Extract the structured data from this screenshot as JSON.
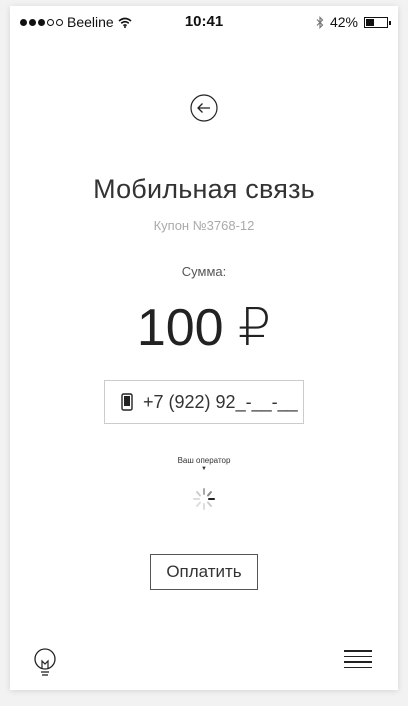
{
  "status_bar": {
    "carrier": "Beeline",
    "time": "10:41",
    "battery_percent": "42%",
    "battery_level": 0.42,
    "signal_bars_filled": 3,
    "signal_bars_total": 5
  },
  "header": {
    "title": "Мобильная связь",
    "coupon": "Купон №3768-12"
  },
  "payment": {
    "sum_label": "Сумма:",
    "amount": "100 ₽"
  },
  "phone_field": {
    "value": "+7 (922) 92_-__-__"
  },
  "operator": {
    "label": "Ваш оператор",
    "caret": "▼"
  },
  "actions": {
    "pay_label": "Оплатить"
  },
  "icons": {
    "back": "back-arrow-icon",
    "phone": "mobile-phone-icon",
    "spinner": "loading-spinner-icon",
    "bulb": "lightbulb-icon",
    "menu": "menu-icon",
    "wifi": "wifi-icon",
    "bluetooth": "bluetooth-icon",
    "battery": "battery-icon"
  }
}
